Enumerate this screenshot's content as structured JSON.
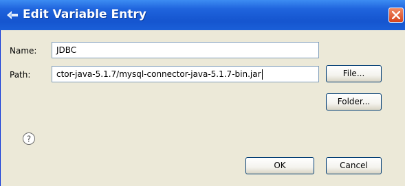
{
  "window": {
    "title": "Edit Variable Entry"
  },
  "form": {
    "name_label": "Name:",
    "name_value": "JDBC",
    "path_label": "Path:",
    "path_value": "ctor-java-5.1.7/mysql-connector-java-5.1.7-bin.jar"
  },
  "buttons": {
    "file": "File...",
    "folder": "Folder...",
    "ok": "OK",
    "cancel": "Cancel"
  },
  "icons": {
    "title": "eclipse-dialog-icon",
    "close": "close-icon",
    "help": "help-icon"
  },
  "colors": {
    "titlebar": "#1f64dd",
    "close": "#d6431c",
    "dialog_background": "#ece9d8"
  }
}
